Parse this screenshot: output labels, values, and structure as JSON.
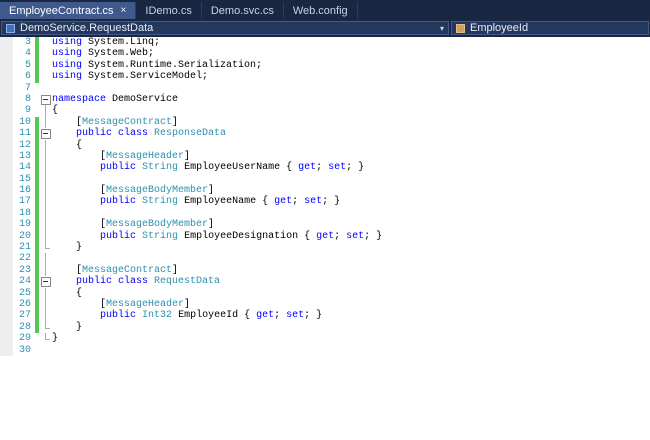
{
  "tabs": [
    {
      "label": "EmployeeContract.cs",
      "active": true,
      "close_glyph": "×"
    },
    {
      "label": "IDemo.cs",
      "active": false
    },
    {
      "label": "Demo.svc.cs",
      "active": false
    },
    {
      "label": "Web.config",
      "active": false
    }
  ],
  "navbar": {
    "type_dropdown_value": "DemoService.RequestData",
    "member_dropdown_value": "EmployeeId",
    "dropdown_arrow": "▾"
  },
  "colors": {
    "keyword": "#0000ff",
    "type": "#2b91af",
    "plain": "#000000",
    "line_number": "#2b91af",
    "change_bar_green": "#53c653",
    "active_tab": "#40598c",
    "tab_bar_background": "#1a2742"
  },
  "editor": {
    "lines": [
      {
        "n": 3,
        "green": true,
        "fold": "",
        "tokens": [
          [
            "k",
            "using"
          ],
          [
            "p",
            " System.Linq;"
          ]
        ]
      },
      {
        "n": 4,
        "green": true,
        "fold": "",
        "tokens": [
          [
            "k",
            "using"
          ],
          [
            "p",
            " System.Web;"
          ]
        ]
      },
      {
        "n": 5,
        "green": true,
        "fold": "",
        "tokens": [
          [
            "k",
            "using"
          ],
          [
            "p",
            " System.Runtime.Serialization;"
          ]
        ]
      },
      {
        "n": 6,
        "green": true,
        "fold": "",
        "tokens": [
          [
            "k",
            "using"
          ],
          [
            "p",
            " System.ServiceModel;"
          ]
        ]
      },
      {
        "n": 7,
        "green": false,
        "fold": "",
        "tokens": []
      },
      {
        "n": 8,
        "green": false,
        "fold": "minus",
        "tokens": [
          [
            "k",
            "namespace"
          ],
          [
            "p",
            " DemoService"
          ]
        ]
      },
      {
        "n": 9,
        "green": false,
        "fold": "vline",
        "tokens": [
          [
            "p",
            "{"
          ]
        ]
      },
      {
        "n": 10,
        "green": true,
        "fold": "vline",
        "tokens": [
          [
            "p",
            "    ["
          ],
          [
            "t",
            "MessageContract"
          ],
          [
            "p",
            "]"
          ]
        ]
      },
      {
        "n": 11,
        "green": true,
        "fold": "minus",
        "tokens": [
          [
            "p",
            "    "
          ],
          [
            "k",
            "public class"
          ],
          [
            "p",
            " "
          ],
          [
            "t",
            "ResponseData"
          ]
        ]
      },
      {
        "n": 12,
        "green": true,
        "fold": "vline",
        "tokens": [
          [
            "p",
            "    {"
          ]
        ]
      },
      {
        "n": 13,
        "green": true,
        "fold": "vline",
        "tokens": [
          [
            "p",
            "        ["
          ],
          [
            "t",
            "MessageHeader"
          ],
          [
            "p",
            "]"
          ]
        ]
      },
      {
        "n": 14,
        "green": true,
        "fold": "vline",
        "tokens": [
          [
            "p",
            "        "
          ],
          [
            "k",
            "public"
          ],
          [
            "p",
            " "
          ],
          [
            "t",
            "String"
          ],
          [
            "p",
            " EmployeeUserName { "
          ],
          [
            "k",
            "get"
          ],
          [
            "p",
            "; "
          ],
          [
            "k",
            "set"
          ],
          [
            "p",
            "; }"
          ]
        ]
      },
      {
        "n": 15,
        "green": true,
        "fold": "vline",
        "tokens": []
      },
      {
        "n": 16,
        "green": true,
        "fold": "vline",
        "tokens": [
          [
            "p",
            "        ["
          ],
          [
            "t",
            "MessageBodyMember"
          ],
          [
            "p",
            "]"
          ]
        ]
      },
      {
        "n": 17,
        "green": true,
        "fold": "vline",
        "tokens": [
          [
            "p",
            "        "
          ],
          [
            "k",
            "public"
          ],
          [
            "p",
            " "
          ],
          [
            "t",
            "String"
          ],
          [
            "p",
            " EmployeeName { "
          ],
          [
            "k",
            "get"
          ],
          [
            "p",
            "; "
          ],
          [
            "k",
            "set"
          ],
          [
            "p",
            "; }"
          ]
        ]
      },
      {
        "n": 18,
        "green": true,
        "fold": "vline",
        "tokens": []
      },
      {
        "n": 19,
        "green": true,
        "fold": "vline",
        "tokens": [
          [
            "p",
            "        ["
          ],
          [
            "t",
            "MessageBodyMember"
          ],
          [
            "p",
            "]"
          ]
        ]
      },
      {
        "n": 20,
        "green": true,
        "fold": "vline",
        "tokens": [
          [
            "p",
            "        "
          ],
          [
            "k",
            "public"
          ],
          [
            "p",
            " "
          ],
          [
            "t",
            "String"
          ],
          [
            "p",
            " EmployeeDesignation { "
          ],
          [
            "k",
            "get"
          ],
          [
            "p",
            "; "
          ],
          [
            "k",
            "set"
          ],
          [
            "p",
            "; }"
          ]
        ]
      },
      {
        "n": 21,
        "green": true,
        "fold": "end",
        "tokens": [
          [
            "p",
            "    }"
          ]
        ]
      },
      {
        "n": 22,
        "green": true,
        "fold": "vline",
        "tokens": []
      },
      {
        "n": 23,
        "green": true,
        "fold": "vline",
        "tokens": [
          [
            "p",
            "    ["
          ],
          [
            "t",
            "MessageContract"
          ],
          [
            "p",
            "]"
          ]
        ]
      },
      {
        "n": 24,
        "green": true,
        "fold": "minus",
        "tokens": [
          [
            "p",
            "    "
          ],
          [
            "k",
            "public class"
          ],
          [
            "p",
            " "
          ],
          [
            "t",
            "RequestData"
          ]
        ]
      },
      {
        "n": 25,
        "green": true,
        "fold": "vline",
        "tokens": [
          [
            "p",
            "    {"
          ]
        ]
      },
      {
        "n": 26,
        "green": true,
        "fold": "vline",
        "tokens": [
          [
            "p",
            "        ["
          ],
          [
            "t",
            "MessageHeader"
          ],
          [
            "p",
            "]"
          ]
        ]
      },
      {
        "n": 27,
        "green": true,
        "fold": "vline",
        "tokens": [
          [
            "p",
            "        "
          ],
          [
            "k",
            "public"
          ],
          [
            "p",
            " "
          ],
          [
            "t",
            "Int32"
          ],
          [
            "p",
            " EmployeeId { "
          ],
          [
            "k",
            "get"
          ],
          [
            "p",
            "; "
          ],
          [
            "k",
            "set"
          ],
          [
            "p",
            "; }"
          ]
        ]
      },
      {
        "n": 28,
        "green": true,
        "fold": "end",
        "tokens": [
          [
            "p",
            "    }"
          ]
        ]
      },
      {
        "n": 29,
        "green": false,
        "fold": "end",
        "tokens": [
          [
            "p",
            "}"
          ]
        ]
      },
      {
        "n": 30,
        "green": false,
        "fold": "",
        "tokens": []
      }
    ]
  }
}
